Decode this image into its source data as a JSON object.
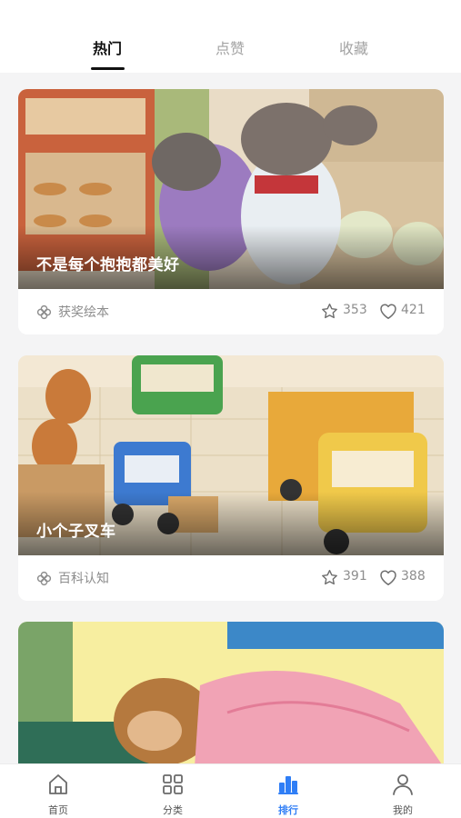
{
  "tabs": [
    {
      "label": "热门",
      "active": true
    },
    {
      "label": "点赞",
      "active": false
    },
    {
      "label": "收藏",
      "active": false
    }
  ],
  "cards": [
    {
      "title": "不是每个抱抱都美好",
      "category": "获奖绘本",
      "category_icon": "clover-icon",
      "stars": "353",
      "likes": "421"
    },
    {
      "title": "小个子叉车",
      "category": "百科认知",
      "category_icon": "clover-icon",
      "stars": "391",
      "likes": "388"
    }
  ],
  "nav": [
    {
      "label": "首页",
      "icon": "home-icon",
      "active": false
    },
    {
      "label": "分类",
      "icon": "grid-icon",
      "active": false
    },
    {
      "label": "排行",
      "icon": "ranking-icon",
      "active": true
    },
    {
      "label": "我的",
      "icon": "user-icon",
      "active": false
    }
  ],
  "colors": {
    "accent": "#2f7ef6",
    "background": "#f4f4f5",
    "muted_text": "#8d8d8d"
  }
}
